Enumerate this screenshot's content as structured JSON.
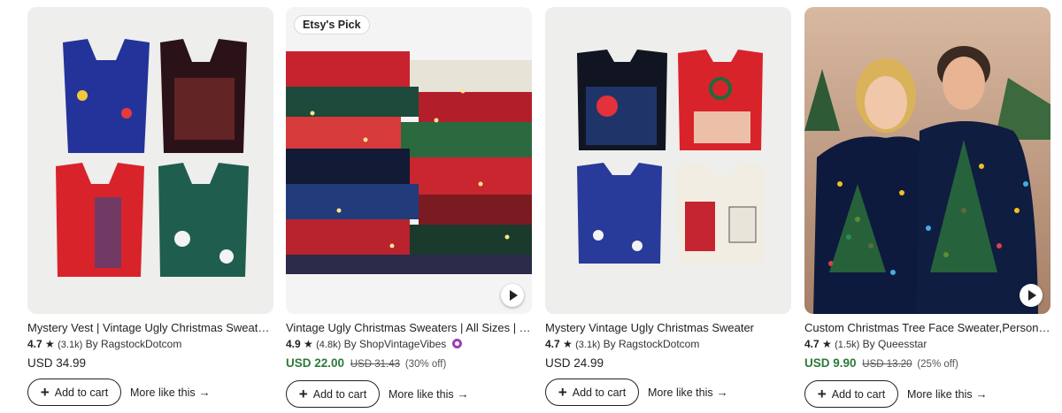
{
  "colors": {
    "sale_price": "#2d7a39",
    "star_seller": "#9a3fb3",
    "image_bg": "#eeeeec"
  },
  "listings": [
    {
      "title": "Mystery Vest | Vintage Ugly Christmas Sweater Vest",
      "rating": "4.7",
      "reviews": "(3.1k)",
      "by": "By",
      "shop": "RagstockDotcom",
      "price": "USD 34.99",
      "image_icon": "vests-photo",
      "add_label": "Add to cart",
      "more_label": "More like this"
    },
    {
      "badge": "Etsy's Pick",
      "title": "Vintage Ugly Christmas Sweaters | All Sizes | Tacky Christmas Sweater",
      "rating": "4.9",
      "reviews": "(4.8k)",
      "by": "By",
      "shop": "ShopVintageVibes",
      "star_seller": true,
      "sale_price": "USD 22.00",
      "original_price": "USD 31.43",
      "discount": "(30% off)",
      "image_icon": "sweater-pile-photo",
      "add_label": "Add to cart",
      "more_label": "More like this"
    },
    {
      "title": "Mystery Vintage Ugly Christmas Sweater",
      "rating": "4.7",
      "reviews": "(3.1k)",
      "by": "By",
      "shop": "RagstockDotcom",
      "price": "USD 24.99",
      "image_icon": "sweaters-photo",
      "add_label": "Add to cart",
      "more_label": "More like this"
    },
    {
      "title": "Custom Christmas Tree Face Sweater,Personalized Photo Sweater",
      "rating": "4.7",
      "reviews": "(1.5k)",
      "by": "By",
      "shop": "Queesstar",
      "sale_price": "USD 9.90",
      "original_price": "USD 13.20",
      "discount": "(25% off)",
      "image_icon": "couple-photo",
      "add_label": "Add to cart",
      "more_label": "More like this"
    }
  ]
}
